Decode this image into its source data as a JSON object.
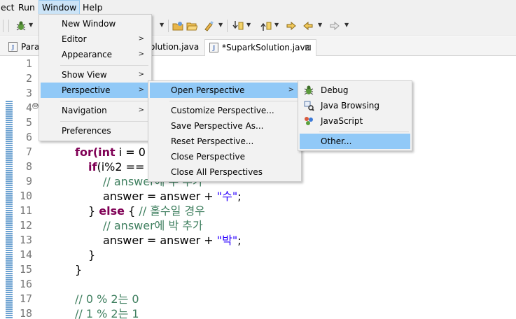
{
  "menubar": {
    "items": [
      {
        "label": "ect",
        "mnemonic": ""
      },
      {
        "label": "Run",
        "mnemonic": "R"
      },
      {
        "label": "Window",
        "mnemonic": "W"
      },
      {
        "label": "Help",
        "mnemonic": "H"
      }
    ]
  },
  "toolbar": {
    "icons": [
      "debug-icon",
      "open-folder-icon",
      "folder-icon",
      "brush-icon",
      "next-annotation-icon",
      "prev-annotation-icon",
      "last-edit-icon",
      "back-icon",
      "forward-icon"
    ]
  },
  "tabs": [
    {
      "label": "Para",
      "active": false
    },
    {
      "label": "olution.java",
      "active": false
    },
    {
      "label": "*SuparkSolution.java",
      "active": true
    }
  ],
  "tab_close_glyph": "⊠",
  "editor": {
    "line_numbers": [
      "1",
      "2",
      "3",
      "4",
      "5",
      "6",
      "7",
      "8",
      "9",
      "10",
      "11",
      "12",
      "13",
      "14",
      "15",
      "16",
      "17",
      "18"
    ],
    "fold_marker": "⊖"
  },
  "window_menu": {
    "items": [
      {
        "label": "New Window",
        "submenu": false
      },
      {
        "label": "Editor",
        "submenu": true
      },
      {
        "label": "Appearance",
        "submenu": true
      },
      {
        "label": "Show View",
        "submenu": true
      },
      {
        "label": "Perspective",
        "submenu": true,
        "highlighted": true
      },
      {
        "label": "Navigation",
        "submenu": true
      },
      {
        "label": "Preferences",
        "submenu": false
      }
    ]
  },
  "perspective_menu": {
    "items": [
      {
        "label": "Open Perspective",
        "submenu": true
      },
      {
        "label": "Customize Perspective..."
      },
      {
        "label": "Save Perspective As..."
      },
      {
        "label": "Reset Perspective..."
      },
      {
        "label": "Close Perspective"
      },
      {
        "label": "Close All Perspectives"
      }
    ]
  },
  "open_perspective_menu": {
    "items": [
      {
        "label": "Debug",
        "icon": "debug-bug-icon"
      },
      {
        "label": "Java Browsing",
        "icon": "java-browsing-icon"
      },
      {
        "label": "JavaScript",
        "icon": "javascript-icon"
      },
      {
        "label": "Other...",
        "highlighted": true
      }
    ]
  },
  "code": {
    "line7_a": "for(",
    "line7_kw": "int",
    "line7_b": " i = 0",
    "line8_kw": "if",
    "line8_b": "(i%2 ==",
    "line9_cm": "// answer에 수 추가",
    "line10_a": "answer = answer + ",
    "line10_st": "\"수\"",
    "line10_b": ";",
    "line11_a": "} ",
    "line11_kw": "else",
    "line11_b": " { ",
    "line11_cm": "// 홀수일 경우",
    "line12_cm": "// answer에 박 추가",
    "line13_a": "answer = answer + ",
    "line13_st": "\"박\"",
    "line13_b": ";",
    "line14": "}",
    "line15": "}",
    "line17_cm": "// 0 % 2는 0",
    "line18_cm": "// 1 % 2는 1"
  },
  "colors": {
    "keyword": "#7f0055",
    "comment": "#3f7f5f",
    "string": "#2a00ff",
    "menu_highlight": "#91c9f7"
  }
}
